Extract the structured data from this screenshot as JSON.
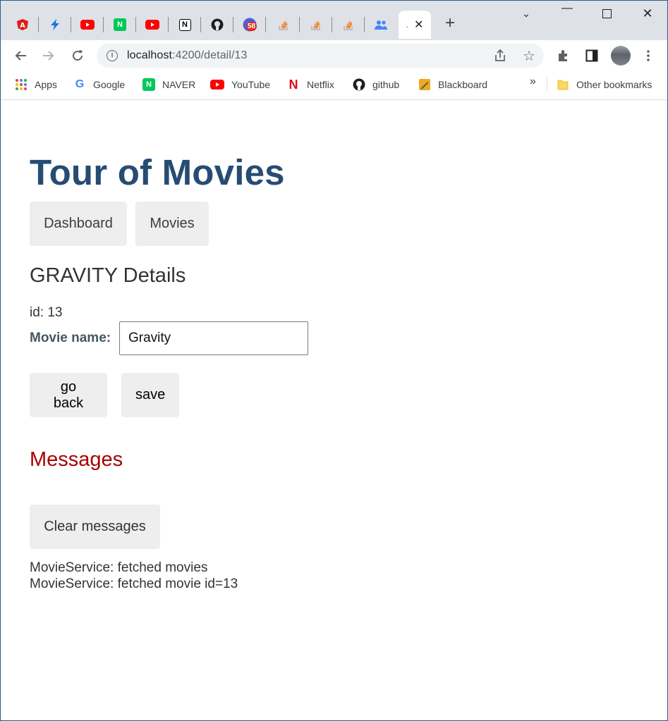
{
  "browser": {
    "tabs": [
      {
        "icon": "angular-icon"
      },
      {
        "icon": "lightning-icon"
      },
      {
        "icon": "youtube-icon"
      },
      {
        "icon": "naver-icon"
      },
      {
        "icon": "youtube-icon"
      },
      {
        "icon": "notion-icon"
      },
      {
        "icon": "github-icon"
      },
      {
        "icon": "notification-icon",
        "badge": "58"
      },
      {
        "icon": "stackoverflow-icon"
      },
      {
        "icon": "stackoverflow-icon"
      },
      {
        "icon": "stackoverflow-icon"
      },
      {
        "icon": "people-icon"
      }
    ],
    "active_tab_label": ".",
    "url_host": "localhost",
    "url_path": ":4200/detail/13",
    "bookmarks": {
      "apps": "Apps",
      "google": "Google",
      "naver": "NAVER",
      "youtube": "YouTube",
      "netflix": "Netflix",
      "github": "github",
      "blackboard": "Blackboard",
      "overflow": "»",
      "other": "Other bookmarks"
    }
  },
  "page": {
    "title": "Tour of Movies",
    "nav": {
      "dashboard": "Dashboard",
      "movies": "Movies"
    },
    "detail_title": "GRAVITY Details",
    "id_label": "id: ",
    "id_value": "13",
    "name_label": "Movie name:",
    "name_value": "Gravity",
    "go_back": "go back",
    "save": "save",
    "messages_title": "Messages",
    "clear_messages": "Clear messages",
    "messages": [
      "MovieService: fetched movies",
      "MovieService: fetched movie id=13"
    ]
  },
  "colors": {
    "title": "#264c73",
    "messages_title": "#a80000",
    "button_bg": "#eeeeee"
  }
}
